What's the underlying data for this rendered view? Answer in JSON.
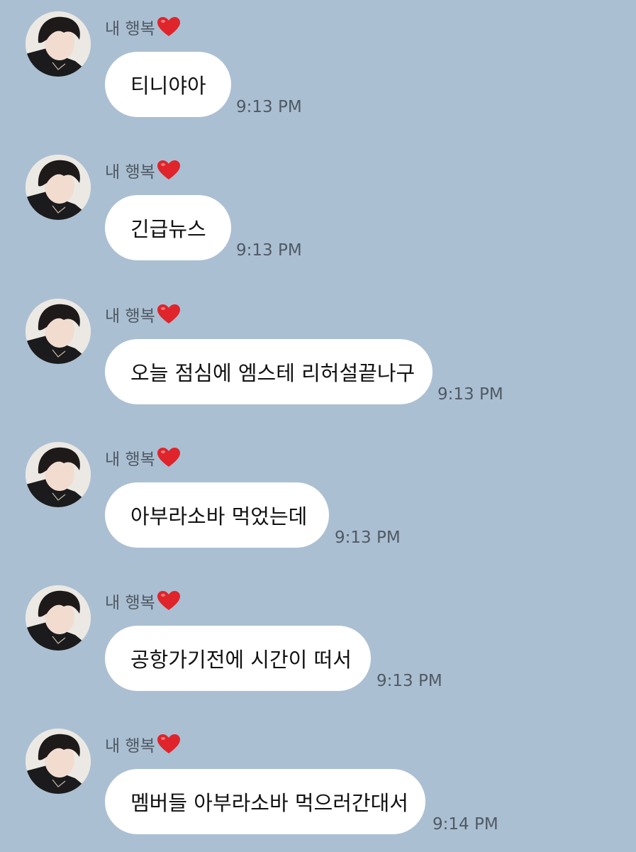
{
  "chat": {
    "messages": [
      {
        "sender": "내 행복",
        "sender_emoji": "heart",
        "text": "티니야아",
        "time": "9:13 PM"
      },
      {
        "sender": "내 행복",
        "sender_emoji": "heart",
        "text": "긴급뉴스",
        "time": "9:13 PM"
      },
      {
        "sender": "내 행복",
        "sender_emoji": "heart",
        "text": "오늘 점심에 엠스테 리허설끝나구",
        "time": "9:13 PM"
      },
      {
        "sender": "내 행복",
        "sender_emoji": "heart",
        "text": "아부라소바 먹었는데",
        "time": "9:13 PM"
      },
      {
        "sender": "내 행복",
        "sender_emoji": "heart",
        "text": "공항가기전에 시간이 떠서",
        "time": "9:13 PM"
      },
      {
        "sender": "내 행복",
        "sender_emoji": "heart",
        "text": "멤버들 아부라소바 먹으러간대서",
        "time": "9:14 PM"
      }
    ]
  },
  "colors": {
    "background": "#abbfd2",
    "bubble": "#ffffff",
    "heart": "#e0242b",
    "timestamp": "#505a65"
  }
}
